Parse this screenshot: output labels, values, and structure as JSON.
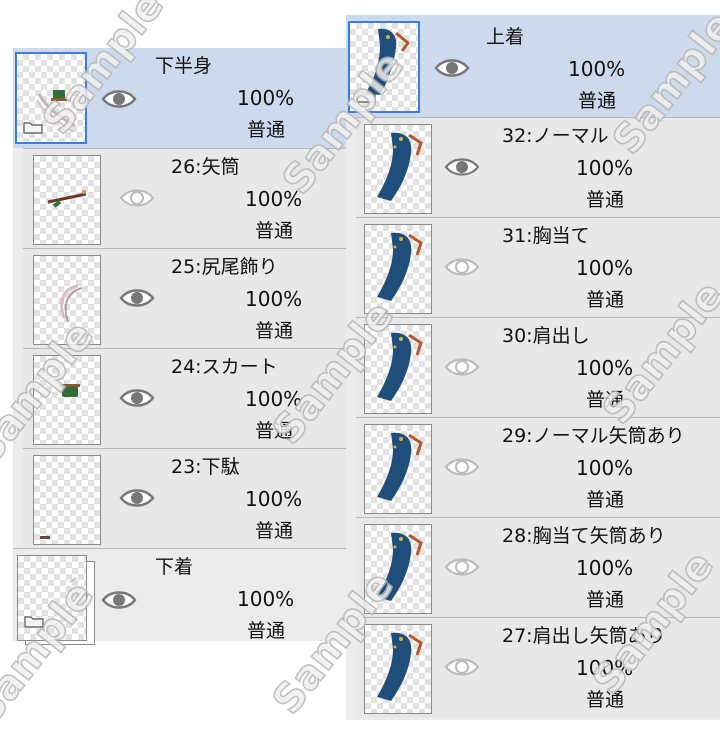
{
  "left_panel": {
    "group": {
      "name": "下半身",
      "opacity": "100%",
      "blend": "普通",
      "icon": "folder-icon",
      "visibility_icon": "eye-icon"
    },
    "layers": [
      {
        "name": "26:矢筒",
        "opacity": "100%",
        "blend": "普通",
        "visible": false
      },
      {
        "name": "25:尻尾飾り",
        "opacity": "100%",
        "blend": "普通",
        "visible": true
      },
      {
        "name": "24:スカート",
        "opacity": "100%",
        "blend": "普通",
        "visible": true
      },
      {
        "name": "23:下駄",
        "opacity": "100%",
        "blend": "普通",
        "visible": true
      }
    ],
    "folder_below": {
      "name": "下着",
      "opacity": "100%",
      "blend": "普通",
      "icon": "folder-icon"
    }
  },
  "right_panel": {
    "group": {
      "name": "上着",
      "opacity": "100%",
      "blend": "普通",
      "icon": "folder-icon"
    },
    "layers": [
      {
        "name": "32:ノーマル",
        "opacity": "100%",
        "blend": "普通",
        "visible": true
      },
      {
        "name": "31:胸当て",
        "opacity": "100%",
        "blend": "普通",
        "visible": false
      },
      {
        "name": "30:肩出し",
        "opacity": "100%",
        "blend": "普通",
        "visible": false
      },
      {
        "name": "29:ノーマル矢筒あり",
        "opacity": "100%",
        "blend": "普通",
        "visible": false
      },
      {
        "name": "28:胸当て矢筒あり",
        "opacity": "100%",
        "blend": "普通",
        "visible": false
      },
      {
        "name": "27:肩出し矢筒あり",
        "opacity": "100%",
        "blend": "普通",
        "visible": false
      }
    ]
  },
  "watermark": "Sample",
  "colors": {
    "selected_row": "#cdd9ec",
    "selection_border": "#3a7fe0",
    "panel_bg": "#ececec",
    "eye_visible": "#777777",
    "eye_hidden": "#bbbbbb"
  }
}
